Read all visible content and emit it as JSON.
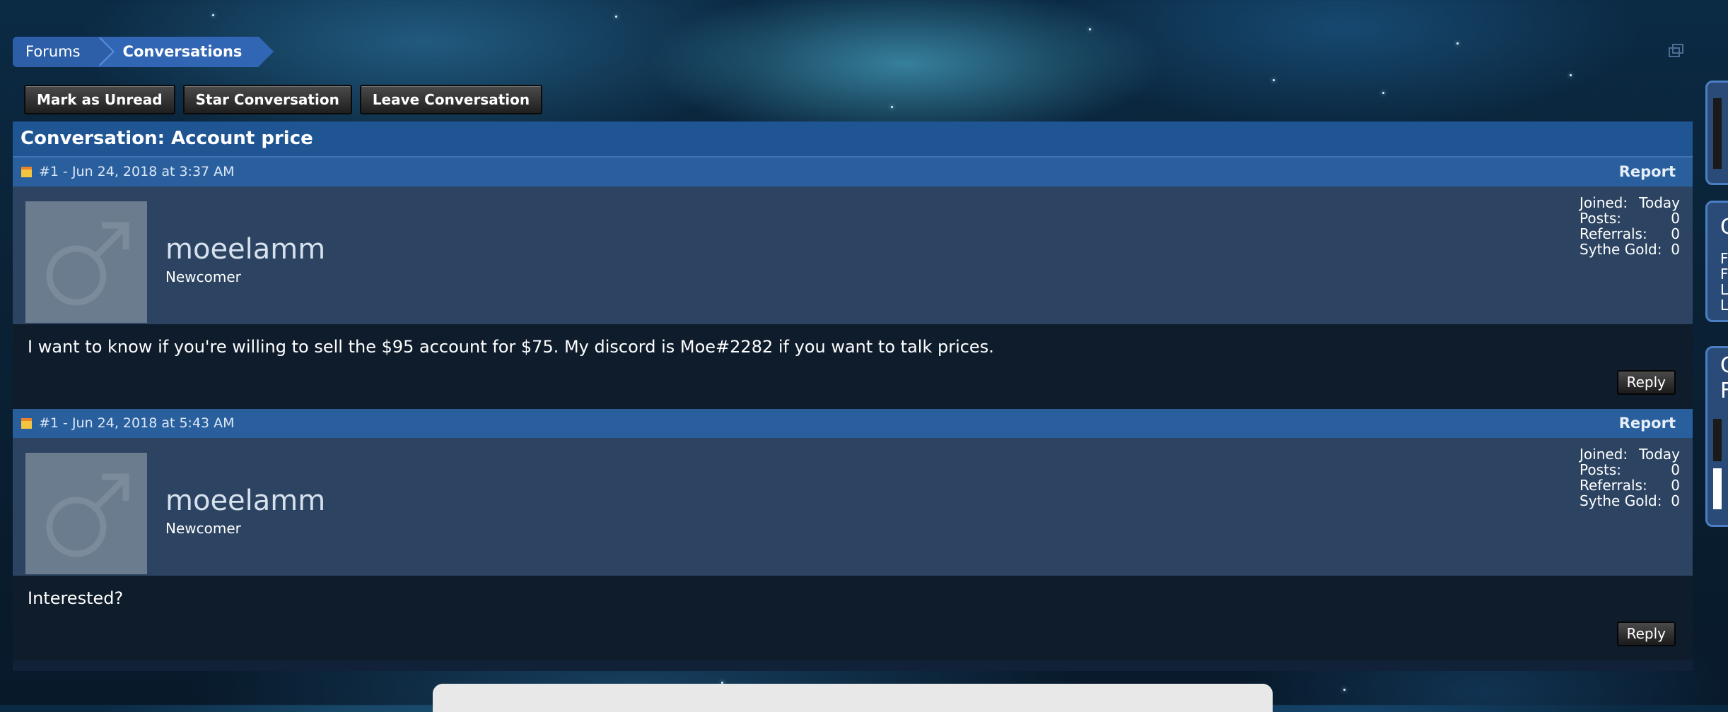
{
  "breadcrumb": {
    "items": [
      "Forums",
      "Conversations"
    ]
  },
  "actions": {
    "mark_unread": "Mark as Unread",
    "star": "Star Conversation",
    "leave": "Leave Conversation"
  },
  "conversation": {
    "title": "Conversation: Account price",
    "report_label": "Report",
    "reply_label": "Reply",
    "stat_labels": {
      "joined": "Joined:",
      "posts": "Posts:",
      "referrals": "Referrals:",
      "gold": "Sythe Gold:"
    },
    "messages": [
      {
        "header": "#1 - Jun 24, 2018 at 3:37 AM",
        "username": "moeelamm",
        "rank": "Newcomer",
        "joined": "Today",
        "posts": "0",
        "referrals": "0",
        "gold": "0",
        "text": "I want to know if you're willing to sell the $95 account for $75. My discord is Moe#2282 if you want to talk prices."
      },
      {
        "header": "#1 - Jun 24, 2018 at 5:43 AM",
        "username": "moeelamm",
        "rank": "Newcomer",
        "joined": "Today",
        "posts": "0",
        "referrals": "0",
        "gold": "0",
        "text": "Interested?"
      }
    ]
  },
  "sidebar_fragments": {
    "second": [
      "C",
      "F",
      "F",
      "L",
      "L"
    ],
    "third": [
      "C",
      "F"
    ]
  },
  "colors": {
    "panel_header": "#1f5592",
    "message_header": "#2a5f9e",
    "user_block": "#2c4461",
    "body": "#0f1c2c"
  }
}
